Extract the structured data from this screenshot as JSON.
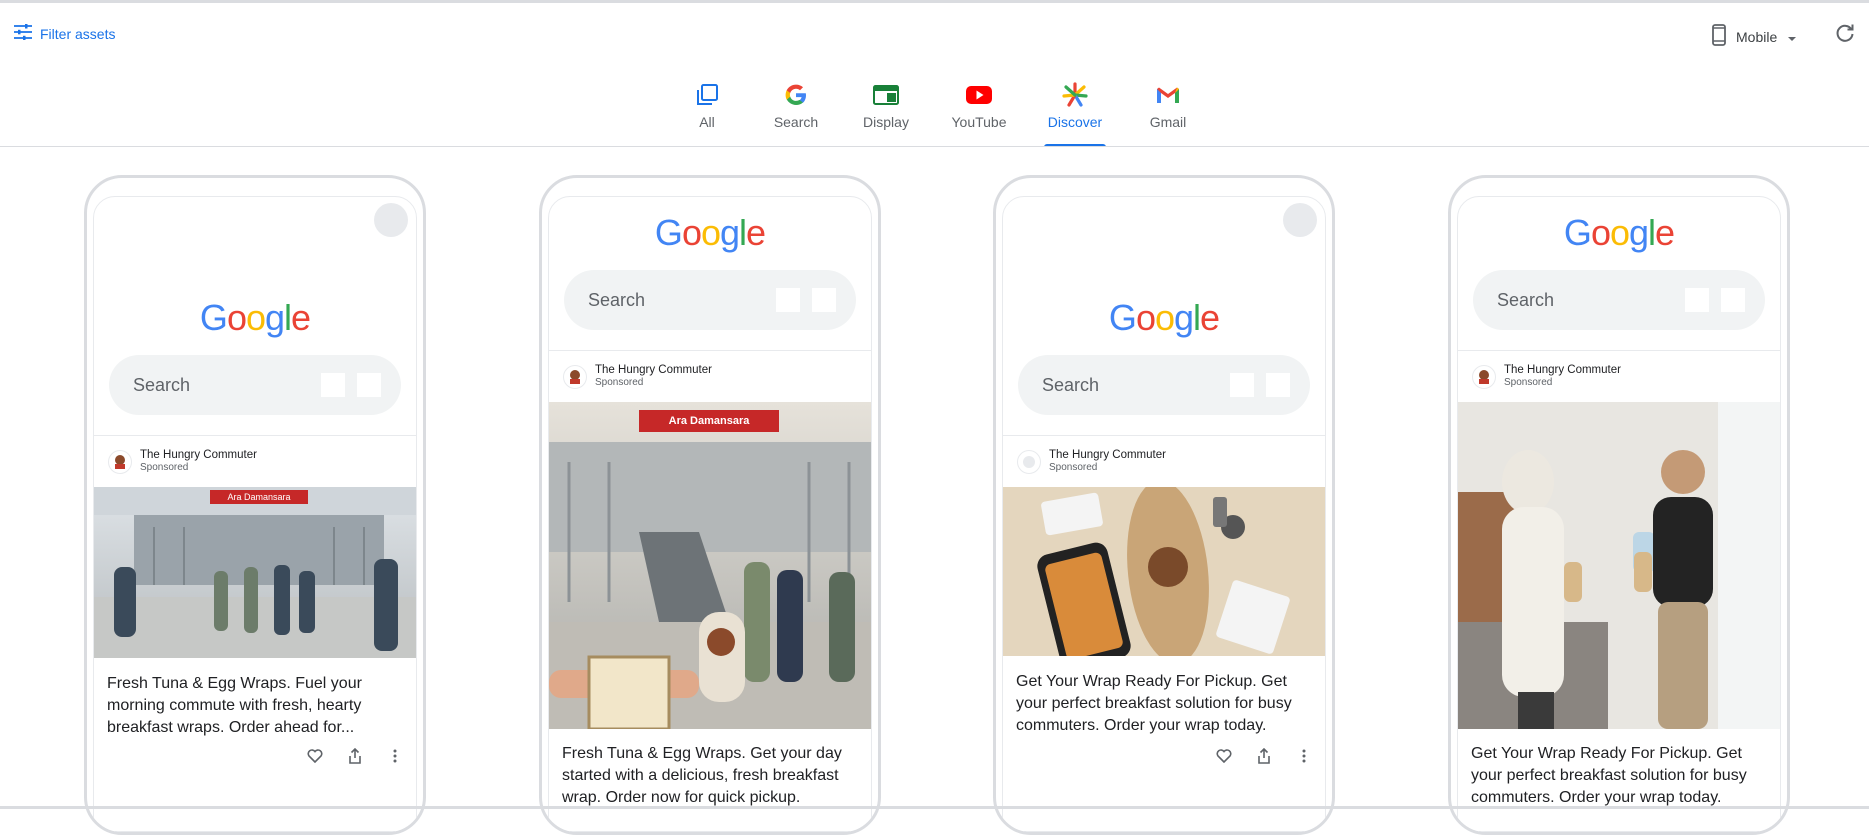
{
  "toolbar": {
    "filter_label": "Filter assets",
    "device_label": "Mobile"
  },
  "tabs": [
    {
      "label": "All",
      "icon": "all-icon"
    },
    {
      "label": "Search",
      "icon": "google-g-icon"
    },
    {
      "label": "Display",
      "icon": "display-icon"
    },
    {
      "label": "YouTube",
      "icon": "youtube-icon"
    },
    {
      "label": "Discover",
      "icon": "discover-icon",
      "active": true
    },
    {
      "label": "Gmail",
      "icon": "gmail-icon"
    }
  ],
  "google_logo": [
    "G",
    "o",
    "o",
    "g",
    "l",
    "e"
  ],
  "search_placeholder": "Search",
  "previews": [
    {
      "advertiser": "The Hungry Commuter",
      "sponsored": "Sponsored",
      "image_sign": "Ara Damansara",
      "text": "Fresh Tuna & Egg Wraps. Fuel your morning commute with fresh, hearty breakfast wraps. Order ahead for..."
    },
    {
      "advertiser": "The Hungry Commuter",
      "sponsored": "Sponsored",
      "image_sign": "Ara Damansara",
      "text": "Fresh Tuna & Egg Wraps. Get your day started with a delicious, fresh breakfast wrap. Order now for quick pickup."
    },
    {
      "advertiser": "The Hungry Commuter",
      "sponsored": "Sponsored",
      "image_sign": "",
      "text": "Get Your Wrap Ready For Pickup. Get your perfect breakfast solution for busy commuters. Order your wrap today."
    },
    {
      "advertiser": "The Hungry Commuter",
      "sponsored": "Sponsored",
      "image_sign": "",
      "text": "Get Your Wrap Ready For Pickup. Get your perfect breakfast solution for busy commuters. Order your wrap today."
    }
  ],
  "colors": {
    "accent": "#1a73e8",
    "google_blue": "#4285f4",
    "google_red": "#ea4335",
    "google_yellow": "#fbbc05",
    "google_green": "#34a853"
  }
}
